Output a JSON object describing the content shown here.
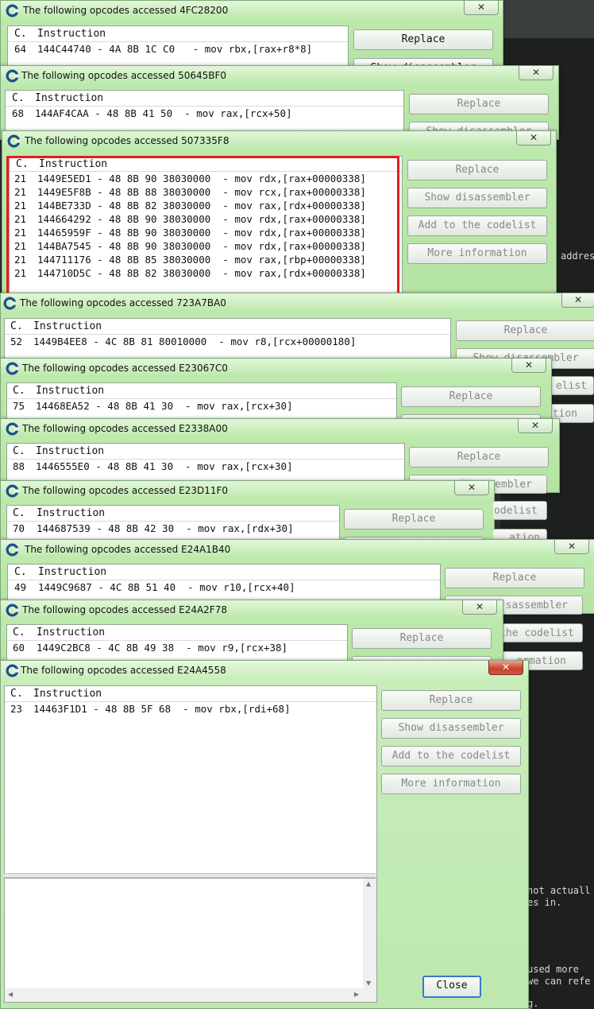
{
  "background": {
    "right_text": [
      "addres",
      "not actuall",
      "es in.",
      "used more",
      "we can refe",
      "g."
    ]
  },
  "column_headers": {
    "count": "C.",
    "instruction": "Instruction"
  },
  "buttons": {
    "replace": "Replace",
    "show_disassembler": "Show disassembler",
    "add_to_codelist": "Add to the codelist",
    "more_information": "More information",
    "close": "Close",
    "partial_show_disassembler": "Show disassembler",
    "partial_disassembler": "disassembler",
    "partial_codelist": "codelist",
    "partial_sassembler": "sassembler",
    "partial_the_codelist": "the codelist",
    "partial_ormation": "ormation",
    "partial_ation": "ation",
    "partial_cion": "tion",
    "partial_elist": "elist",
    "partial_odelist": "odelist"
  },
  "close_glyph": "✕",
  "windows": [
    {
      "title": "The following opcodes accessed 4FC28200",
      "rows": [
        {
          "count": "64",
          "instruction": "144C44740 - 4A 8B 1C C0   - mov rbx,[rax+r8*8]"
        }
      ]
    },
    {
      "title": "The following opcodes accessed 50645BF0",
      "rows": [
        {
          "count": "68",
          "instruction": "144AF4CAA - 48 8B 41 50  - mov rax,[rcx+50]"
        }
      ]
    },
    {
      "title": "The following opcodes accessed 507335F8",
      "rows": [
        {
          "count": "21",
          "instruction": "1449E5ED1 - 48 8B 90 38030000  - mov rdx,[rax+00000338]"
        },
        {
          "count": "21",
          "instruction": "1449E5F8B - 48 8B 88 38030000  - mov rcx,[rax+00000338]"
        },
        {
          "count": "21",
          "instruction": "144BE733D - 48 8B 82 38030000  - mov rax,[rdx+00000338]"
        },
        {
          "count": "21",
          "instruction": "144664292 - 48 8B 90 38030000  - mov rdx,[rax+00000338]"
        },
        {
          "count": "21",
          "instruction": "14465959F - 48 8B 90 38030000  - mov rdx,[rax+00000338]"
        },
        {
          "count": "21",
          "instruction": "144BA7545 - 48 8B 90 38030000  - mov rdx,[rax+00000338]"
        },
        {
          "count": "21",
          "instruction": "144711176 - 48 8B 85 38030000  - mov rax,[rbp+00000338]"
        },
        {
          "count": "21",
          "instruction": "144710D5C - 48 8B 82 38030000  - mov rax,[rdx+00000338]"
        }
      ]
    },
    {
      "title": "The following opcodes accessed 723A7BA0",
      "rows": [
        {
          "count": "52",
          "instruction": "1449B4EE8 - 4C 8B 81 80010000  - mov r8,[rcx+00000180]"
        }
      ]
    },
    {
      "title": "The following opcodes accessed E23067C0",
      "rows": [
        {
          "count": "75",
          "instruction": "14468EA52 - 48 8B 41 30  - mov rax,[rcx+30]"
        }
      ]
    },
    {
      "title": "The following opcodes accessed E2338A00",
      "rows": [
        {
          "count": "88",
          "instruction": "1446555E0 - 48 8B 41 30  - mov rax,[rcx+30]"
        }
      ]
    },
    {
      "title": "The following opcodes accessed E23D11F0",
      "rows": [
        {
          "count": "70",
          "instruction": "144687539 - 48 8B 42 30  - mov rax,[rdx+30]"
        }
      ]
    },
    {
      "title": "The following opcodes accessed E24A1B40",
      "rows": [
        {
          "count": "49",
          "instruction": "1449C9687 - 4C 8B 51 40  - mov r10,[rcx+40]"
        }
      ]
    },
    {
      "title": "The following opcodes accessed E24A2F78",
      "rows": [
        {
          "count": "60",
          "instruction": "1449C2BC8 - 4C 8B 49 38  - mov r9,[rcx+38]"
        }
      ]
    },
    {
      "title": "The following opcodes accessed E24A4558",
      "rows": [
        {
          "count": "23",
          "instruction": "14463F1D1 - 48 8B 5F 68  - mov rbx,[rdi+68]"
        }
      ]
    }
  ]
}
